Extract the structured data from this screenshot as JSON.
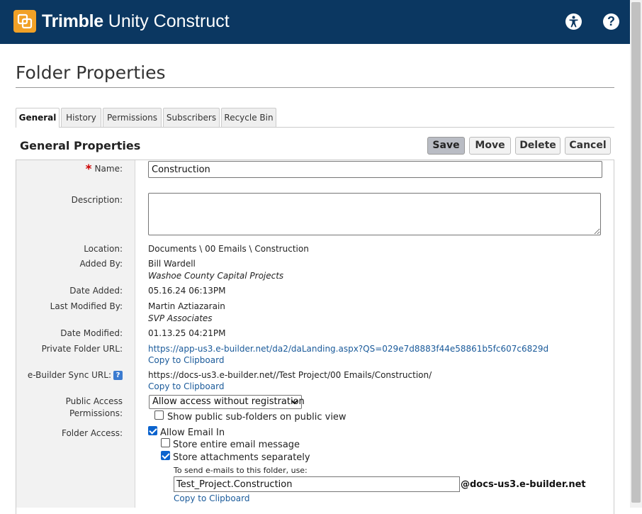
{
  "app": {
    "brand_bold": "Trimble",
    "brand_light": "Unity Construct",
    "help_glyph": "?",
    "colors": {
      "header_bg": "#0b3761",
      "logo": "#f1a127",
      "link": "#1a5a9a",
      "required": "#cc0000"
    }
  },
  "page": {
    "title": "Folder Properties"
  },
  "tabs": [
    {
      "label": "General",
      "active": true
    },
    {
      "label": "History"
    },
    {
      "label": "Permissions"
    },
    {
      "label": "Subscribers"
    },
    {
      "label": "Recycle Bin"
    }
  ],
  "section": {
    "title": "General Properties"
  },
  "buttons": {
    "save": "Save",
    "move": "Move",
    "delete": "Delete",
    "cancel": "Cancel"
  },
  "form": {
    "required_mark": "*",
    "name": {
      "label": "Name:",
      "value": "Construction"
    },
    "description": {
      "label": "Description:",
      "value": ""
    },
    "location": {
      "label": "Location:",
      "value": "Documents \\ 00 Emails \\ Construction"
    },
    "added_by": {
      "label": "Added By:",
      "name": "Bill Wardell",
      "company": "Washoe County Capital Projects"
    },
    "date_added": {
      "label": "Date Added:",
      "value": "05.16.24 06:13PM"
    },
    "last_modified_by": {
      "label": "Last Modified By:",
      "name": "Martin Aztiazarain",
      "company": "SVP Associates"
    },
    "date_modified": {
      "label": "Date Modified:",
      "value": "01.13.25 04:21PM"
    },
    "private_url": {
      "label": "Private Folder URL:",
      "value": "https://app-us3.e-builder.net/da2/daLanding.aspx?QS=029e7d8883f44e58861b5fc607c6829d",
      "copy": "Copy to Clipboard"
    },
    "sync_url": {
      "label": "e-Builder Sync URL:",
      "help_glyph": "?",
      "value": "https://docs-us3.e-builder.net//Test Project/00 Emails/Construction/",
      "copy": "Copy to Clipboard"
    },
    "public_access": {
      "label_line1": "Public Access",
      "label_line2": "Permissions:",
      "selected": "Allow access without registration",
      "show_subfolders": {
        "label": "Show public sub-folders on public view",
        "checked": false
      }
    },
    "folder_access": {
      "label": "Folder Access:",
      "allow_email_in": {
        "label": "Allow Email In",
        "checked": true
      },
      "store_entire": {
        "label": "Store entire email message",
        "checked": false
      },
      "store_attachments": {
        "label": "Store attachments separately",
        "checked": true
      },
      "hint": "To send e-mails to this folder, use:",
      "email_prefix": "Test_Project.Construction",
      "email_domain": "@docs-us3.e-builder.net",
      "copy": "Copy to Clipboard"
    }
  }
}
